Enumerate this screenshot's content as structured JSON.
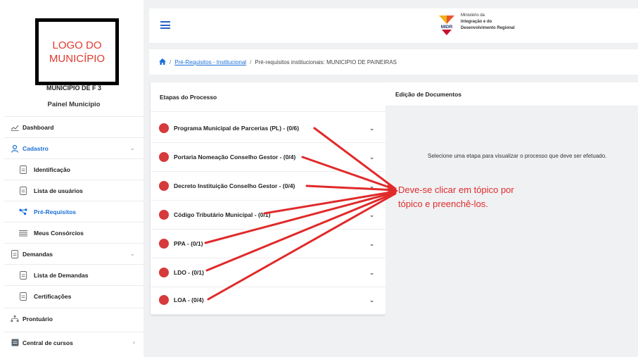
{
  "sidebar": {
    "logo_lines": [
      "LOGO DO",
      "MUNICÍPIO"
    ],
    "municipality": "MUNICIPIO DE F           3",
    "panel_title": "Painel Município",
    "items": [
      {
        "label": "Dashboard",
        "icon": "chart-icon"
      },
      {
        "label": "Cadastro",
        "icon": "user-icon",
        "chevron": "⌄"
      },
      {
        "label": "Identificação",
        "icon": "document-icon"
      },
      {
        "label": "Lista de usuários",
        "icon": "document-icon"
      },
      {
        "label": "Pré-Requisitos",
        "icon": "network-icon"
      },
      {
        "label": "Meus Consórcios",
        "icon": "list-icon"
      },
      {
        "label": "Demandas",
        "icon": "document-icon",
        "chevron": "⌄"
      },
      {
        "label": "Lista de Demandas",
        "icon": "document-icon"
      },
      {
        "label": "Certificações",
        "icon": "document-icon"
      },
      {
        "label": "Prontuário",
        "icon": "tree-icon"
      },
      {
        "label": "Central de cursos",
        "icon": "book-icon",
        "chevron": "‹"
      }
    ]
  },
  "topbar": {
    "ministry_lines": [
      "Ministério da",
      "Integração e do",
      "Desenvolvimento Regional"
    ],
    "logo_text": "MIDR"
  },
  "breadcrumb": {
    "sep": "/",
    "link": "Pré-Requisitos - Institucional",
    "current": "Pré-requisitos institucionais: MUNICIPIO DE PAINEIRAS"
  },
  "process": {
    "title": "Etapas do Processo",
    "steps": [
      "Programa Municipal de Parcerias (PL) - (0/6)",
      "Portaria Nomeação Conselho Gestor - (0/4)",
      "Decreto Instituição Conselho Gestor - (0/4)",
      "Código Tributário Municipal - (0/1)",
      "PPA - (0/1)",
      "LDO - (0/1)",
      "LOA - (0/4)"
    ],
    "caret": "⌄"
  },
  "documents": {
    "title": "Edição de Documentos",
    "message": "Selecione uma etapa para visualizar o processo que deve ser efetuado."
  },
  "annotation": {
    "lines": [
      "Deve-se clicar em tópico por",
      "tópico e preenchê-los."
    ]
  },
  "colors": {
    "accent": "#1a6fd6",
    "status_dot": "#d63a3a",
    "annotation": "#e02a2a"
  }
}
